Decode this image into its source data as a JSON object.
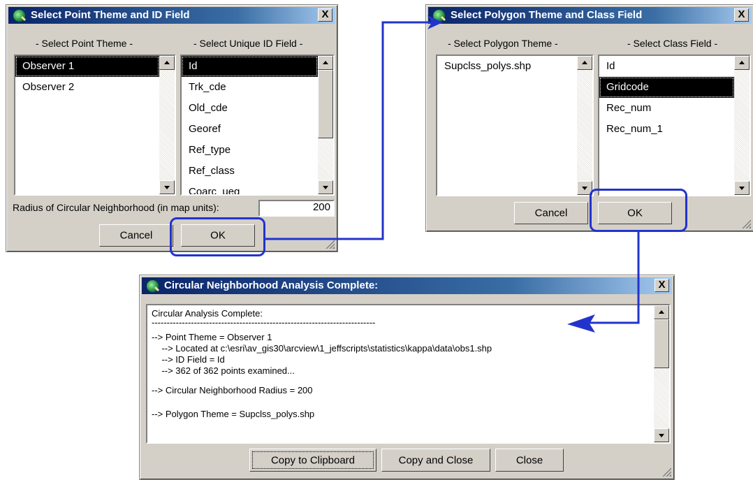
{
  "dialog_point": {
    "title": "Select Point Theme and ID Field",
    "close_label": "X",
    "theme_header": "- Select Point Theme -",
    "field_header": "- Select Unique ID Field -",
    "themes": [
      "Observer 1",
      "Observer 2"
    ],
    "fields": [
      "Id",
      "Trk_cde",
      "Old_cde",
      "Georef",
      "Ref_type",
      "Ref_class",
      "Coarc_ueg"
    ],
    "radius_label": "Radius of Circular Neighborhood (in map units):",
    "radius_value": "200",
    "cancel_label": "Cancel",
    "ok_label": "OK"
  },
  "dialog_polygon": {
    "title": "Select Polygon Theme and Class Field",
    "close_label": "X",
    "theme_header": "- Select Polygon Theme -",
    "field_header": "- Select Class Field -",
    "themes": [
      "Supclss_polys.shp"
    ],
    "fields": [
      "Id",
      "Gridcode",
      "Rec_num",
      "Rec_num_1"
    ],
    "cancel_label": "Cancel",
    "ok_label": "OK"
  },
  "dialog_complete": {
    "title": "Circular Neighborhood Analysis Complete:",
    "close_label": "X",
    "output_lines": [
      "Circular Analysis Complete:",
      "--------------------------------------------------------------------------",
      "--> Point Theme = Observer 1",
      "    --> Located at c:\\esri\\av_gis30\\arcview\\1_jeffscripts\\statistics\\kappa\\data\\obs1.shp",
      "    --> ID Field = Id",
      "    --> 362 of 362 points examined...",
      "",
      "--> Circular Neighborhood Radius = 200",
      "",
      "--> Polygon Theme = Supclss_polys.shp"
    ],
    "copy_clipboard_label": "Copy to Clipboard",
    "copy_close_label": "Copy and Close",
    "close_button_label": "Close"
  },
  "colors": {
    "titlebar_start": "#0a246a",
    "callout_blue": "#2233cc",
    "selection": "#000000",
    "dialog_face": "#d4d0c8"
  }
}
